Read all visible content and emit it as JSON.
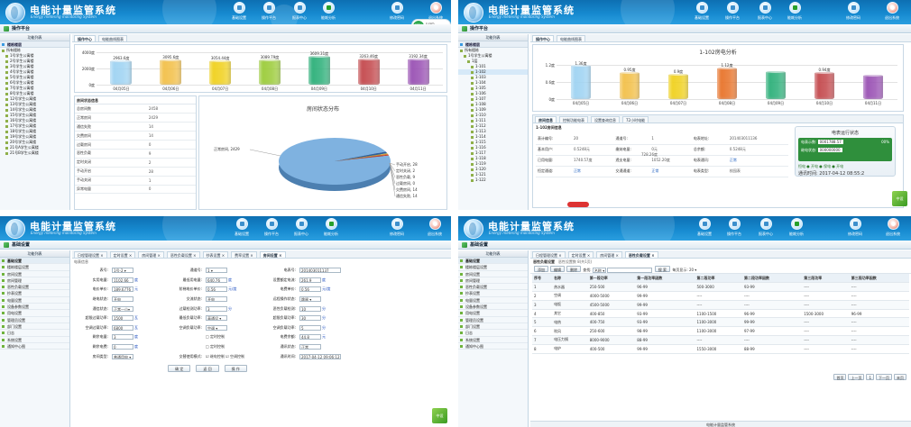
{
  "banner": {
    "title": "电能计量监管系统",
    "subtitle": "Energy metering monitoring System",
    "nav": [
      "基础设置",
      "操作平台",
      "报表中心",
      "能耗分析",
      "修改密码",
      "退出系统"
    ],
    "meter_pct": "67%",
    "meter_legend": [
      "0 kWh",
      "0 kWh"
    ]
  },
  "panel1": {
    "page_title": "操作平台",
    "sb_head": "功能列表",
    "sb_cat": "楼栋楼层",
    "tree_root": "所有楼栋",
    "tree": [
      "1号学生公寓楼",
      "2号学生公寓楼",
      "3号学生公寓楼",
      "4号学生公寓楼",
      "5号学生公寓楼",
      "6号学生公寓楼",
      "7号学生公寓楼",
      "8号学生公寓楼",
      "12号学生公寓楼",
      "13号学生公寓楼",
      "14号学生公寓楼",
      "15号学生公寓楼",
      "16号学生公寓楼",
      "17号学生公寓楼",
      "18号学生公寓楼",
      "19号学生公寓楼",
      "20号学生公寓楼",
      "21号A学生公寓楼",
      "21号B学生公寓楼"
    ],
    "tabs": [
      "操作中心",
      "电能曲线图表"
    ],
    "stat_title": "房间状态信息",
    "stats": [
      [
        "总房间数",
        "2458"
      ],
      [
        "正常房间",
        "2429"
      ],
      [
        "通信失败",
        "14"
      ],
      [
        "欠费房间",
        "14"
      ],
      [
        "过载房间",
        "0"
      ],
      [
        "恶性负载",
        "9"
      ],
      [
        "定时关闭",
        "2"
      ],
      [
        "手动开启",
        "28"
      ],
      [
        "手动关闭",
        "1"
      ],
      [
        "异常电量",
        "0"
      ]
    ],
    "pie_title": "房间状态分布",
    "pie_labels": [
      "正常房间, 2429",
      "手动开启, 28",
      "定时关闭, 2",
      "恶性负载, 9",
      "过载房间, 0",
      "欠费房间, 14",
      "通信失败, 14"
    ]
  },
  "panel2": {
    "page_title": "操作平台",
    "sb_head": "功能列表",
    "sb_cat": "楼栋楼层",
    "tree_root": "所有楼栋",
    "tree_building": "1号学生公寓楼",
    "tree_floor": "1层",
    "rooms": [
      "1-101",
      "1-102",
      "1-103",
      "1-104",
      "1-105",
      "1-106",
      "1-107",
      "1-108",
      "1-109",
      "1-110",
      "1-111",
      "1-112",
      "1-113",
      "1-114",
      "1-115",
      "1-116",
      "1-117",
      "1-118",
      "1-119",
      "1-120",
      "1-121",
      "1-122"
    ],
    "tabs": [
      "操作中心",
      "电能曲线图表"
    ],
    "chart_title": "1-102房电分析",
    "subtabs": [
      "房间信息",
      "控制功能电表",
      "设置查询信息",
      "72小时电能"
    ],
    "info_title": "1-102房间信息",
    "info": [
      [
        "表计编号:",
        "20",
        "通道号:",
        "1",
        "电表地址:",
        "201403011136"
      ],
      [
        "基本用户:",
        "0.5248元",
        "缴纳电量:",
        "0元",
        "总余额:",
        "0.5248元"
      ],
      [
        "已用电量:",
        "1740.57度",
        "透支电量:",
        "1052.20度",
        "电表通讯:",
        "正常"
      ],
      [
        "恒定通道:",
        "正常",
        "交通通道:",
        "正常",
        "电表类型:",
        "校园表"
      ]
    ],
    "extra_value": "728.26度",
    "status_title": "电表运行状态",
    "status_rows": [
      [
        "电表示数:",
        "0001788.57",
        "00%"
      ],
      [
        "继电状态:",
        "000000000",
        ""
      ]
    ],
    "status_flags": "恒电 ● 开电 ● 保电 ● 开电",
    "comm_time_label": "通讯时间:",
    "comm_time": "2017-04-12 08:55:2",
    "badge": "中设"
  },
  "panel3": {
    "page_title": "基础设置",
    "sb_head": "功能列表",
    "menu": [
      "基础设置",
      "楼栋楼层设置",
      "房间设置",
      "房间管理",
      "恶性负载设置",
      "抄表设置",
      "电量设置",
      "设备参数设置",
      "用电设置",
      "管理员设置",
      "部门设置",
      "日志",
      "系统设置",
      "通知中心图"
    ],
    "tabs": [
      "日程管理设置 ×",
      "定时设置 ×",
      "房间管理 ×",
      "恶性负载设置 ×",
      "抄表设置 ×",
      "费率设置 ×",
      "房间设置 ×"
    ],
    "form_caption": "电表信息",
    "rows": [
      [
        [
          "表号:",
          "1号-2 ▾",
          ""
        ],
        [
          "通道号:",
          "1 ▾",
          ""
        ],
        [
          "电表号:",
          "201403011137",
          ""
        ]
      ],
      [
        [
          "实用电量:",
          "1102.66",
          "度"
        ],
        [
          "最低用电量:",
          "640.76",
          "度"
        ],
        [
          "设置额定电流:",
          "261.9",
          "度"
        ]
      ],
      [
        [
          "电价单价:",
          "189.6776",
          "元"
        ],
        [
          "阶梯电价单价:",
          "0.56",
          "元/度"
        ],
        [
          "电费单价:",
          "0.56",
          "元/度"
        ]
      ],
      [
        [
          "继电状态:",
          "开电",
          ""
        ],
        [
          "交流状态:",
          "开电",
          ""
        ],
        [
          "远程操作状态:",
          "跳闸 ▾",
          ""
        ]
      ],
      [
        [
          "通信状态:",
          "正常一小▾",
          ""
        ],
        [
          "过载检测功率:",
          "3",
          "分"
        ],
        [
          "恶性负载检测:",
          "10",
          "分"
        ]
      ],
      [
        [
          "超限过载功率:",
          "1500",
          "瓦"
        ],
        [
          "最低负载功率:",
          "高通设 ▾",
          ""
        ],
        [
          "超限负载功率:",
          "30",
          "分"
        ]
      ],
      [
        [
          "空调过载功率:",
          "6800",
          "瓦"
        ],
        [
          "空调负载功率:",
          "空调 ▾",
          ""
        ],
        [
          "空调负载功率:",
          "5",
          "分"
        ]
      ],
      [
        [
          "剩余电量:",
          "3",
          "度"
        ],
        [
          "",
          "□ 定时控制",
          ""
        ],
        [
          "电费余额:",
          "44.8",
          "元"
        ]
      ],
      [
        [
          "剩余电费:",
          "0",
          "度"
        ],
        [
          "",
          "□ 定时控制",
          ""
        ],
        [
          "通讯状态:",
          "正常",
          ""
        ]
      ],
      [
        [
          "房间类型:",
          "普通用电 ▾",
          ""
        ],
        [
          "交替使用模式:",
          "☑ 继电控制 ☑ 空调控制",
          ""
        ],
        [
          "通讯时间:",
          "2017-04-12 09:06:12",
          ""
        ]
      ]
    ],
    "buttons": [
      "确 定",
      "返 回",
      "操 作"
    ],
    "badge": "中设"
  },
  "panel4": {
    "page_title": "基础设置",
    "sb_head": "功能列表",
    "menu": [
      "基础设置",
      "楼栋楼层设置",
      "房间设置",
      "房间管理",
      "恶性负载设置",
      "抄表设置",
      "电量设置",
      "设备参数设置",
      "用电设置",
      "管理员设置",
      "部门设置",
      "日志",
      "系统设置",
      "通知中心图"
    ],
    "tabs": [
      "日程管理设置 ×",
      "定时设置 ×",
      "房间管理 ×",
      "恶性负载设置 ×"
    ],
    "grid_title": "恶性负载设置",
    "grid_sub": "恶性设置数 8(共1页)",
    "toolbar": [
      "添加",
      "编辑",
      "删除",
      "查找:",
      "名称 ▾",
      "搜 索",
      "每页显示: 20 ▾"
    ],
    "headers": [
      "序号",
      "名称",
      "第一段功率",
      "第一段功率因数",
      "第二段功率",
      "第二段功率因数",
      "第三段功率",
      "第三段功率因数"
    ],
    "rows": [
      [
        "1",
        "热水器",
        "250-500",
        "96-99",
        "500-3000",
        "93-99",
        "----",
        "----"
      ],
      [
        "2",
        "空调",
        "4000-5000",
        "99-99",
        "----",
        "----",
        "----",
        "----"
      ],
      [
        "3",
        "电饭",
        "4500-5000",
        "99-99",
        "----",
        "----",
        "----",
        "----"
      ],
      [
        "4",
        "其它",
        "400-850",
        "93-99",
        "1100-1500",
        "96-99",
        "1500-3000",
        "96-99"
      ],
      [
        "5",
        "电热",
        "400-750",
        "93-99",
        "1100-3000",
        "99-99",
        "----",
        "----"
      ],
      [
        "6",
        "吹风",
        "250-600",
        "98-99",
        "1100-3000",
        "97-99",
        "----",
        "----"
      ],
      [
        "7",
        "电压力锅",
        "8000-9000",
        "88-99",
        "----",
        "----",
        "----",
        "----"
      ],
      [
        "8",
        "电炉",
        "400-500",
        "99-99",
        "1550-3000",
        "88-99",
        "----",
        "----"
      ]
    ],
    "pager": [
      "首页",
      "上一页",
      "1",
      "下一页",
      "末页"
    ],
    "footer": "电能计量监管系统"
  },
  "chart_data": [
    {
      "type": "bar",
      "categories": [
        "04月05日",
        "04月06日",
        "04月07日",
        "04月08日",
        "04月09日",
        "04月10日",
        "04月11日"
      ],
      "values": [
        2963.6,
        3095.6,
        3054.44,
        3089.79,
        3609.31,
        3263.46,
        3192.34
      ],
      "value_labels": [
        "2963.6度",
        "3095.6度",
        "3054.44度",
        "3089.79度",
        "3609.31度",
        "3263.46度",
        "3192.34度"
      ],
      "colors": [
        "#9fd3f2",
        "#f2c04a",
        "#f0d11f",
        "#9ccc3b",
        "#2eb07a",
        "#c44a4e",
        "#9a52b4"
      ],
      "ylim": [
        0,
        4000
      ],
      "yticks": [
        "4000度",
        "2000度",
        "0度"
      ]
    },
    {
      "type": "pie",
      "title": "房间状态分布",
      "categories": [
        "正常房间",
        "手动开启",
        "定时关闭",
        "恶性负载",
        "过载房间",
        "欠费房间",
        "通信失败"
      ],
      "values": [
        2429,
        28,
        2,
        9,
        0,
        14,
        14
      ],
      "colors": [
        "#7fb2e0",
        "#2f5e9c",
        "#4a7a2f",
        "#d3c13a",
        "#8a4fa6",
        "#d67c2a",
        "#c23b2b"
      ]
    },
    {
      "type": "bar",
      "title": "1-102房电分析",
      "categories": [
        "04月05日",
        "04月06日",
        "04月07日",
        "04月08日",
        "04月09日",
        "04月10日",
        "04月11日"
      ],
      "values": [
        1.36,
        0.95,
        0.9,
        1.12,
        0.99,
        0.94,
        0.85
      ],
      "value_labels": [
        "1.36度",
        "0.95度",
        "0.9度",
        "1.12度",
        "",
        "0.94度",
        ""
      ],
      "colors": [
        "#9fd3f2",
        "#f2c04a",
        "#f0d11f",
        "#e8742b",
        "#2eb07a",
        "#c44a4e",
        "#9a52b4"
      ],
      "ylim": [
        0,
        1.2
      ],
      "yticks": [
        "1.2度",
        "0.6度",
        "0度"
      ]
    }
  ]
}
